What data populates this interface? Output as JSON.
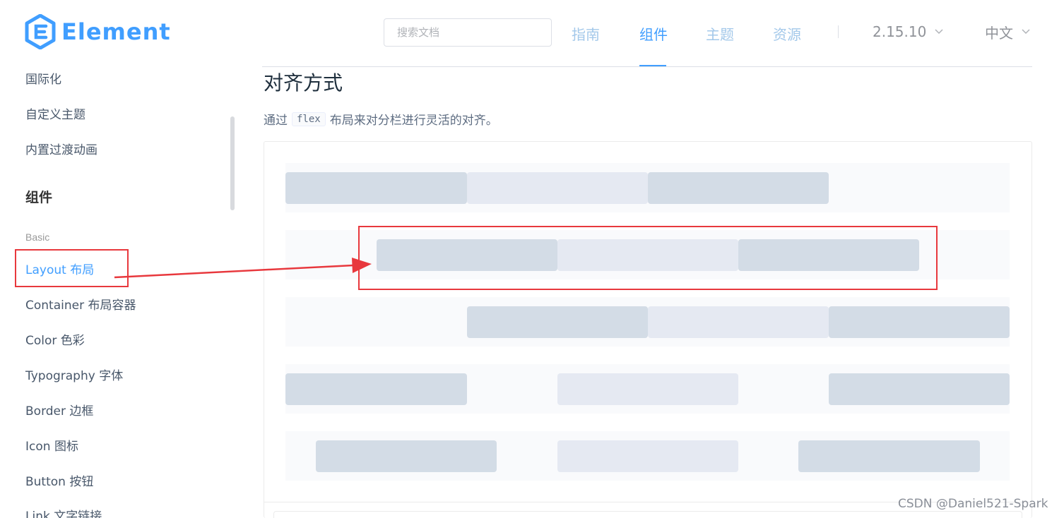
{
  "header": {
    "logo_text": "Element",
    "search_placeholder": "搜索文档",
    "nav": [
      {
        "label": "指南",
        "active": false
      },
      {
        "label": "组件",
        "active": true
      },
      {
        "label": "主题",
        "active": false
      },
      {
        "label": "资源",
        "active": false
      }
    ],
    "version": "2.15.10",
    "language": "中文"
  },
  "sidebar": {
    "items_top": [
      "国际化",
      "自定义主题",
      "内置过渡动画"
    ],
    "group_title": "组件",
    "category": "Basic",
    "items": [
      {
        "label": "Layout 布局",
        "active": true
      },
      {
        "label": "Container 布局容器",
        "active": false
      },
      {
        "label": "Color 色彩",
        "active": false
      },
      {
        "label": "Typography 字体",
        "active": false
      },
      {
        "label": "Border 边框",
        "active": false
      },
      {
        "label": "Icon 图标",
        "active": false
      },
      {
        "label": "Button 按钮",
        "active": false
      },
      {
        "label": "Link 文字链接",
        "active": false
      }
    ]
  },
  "main": {
    "title": "对齐方式",
    "desc_before": "通过",
    "desc_code": "flex",
    "desc_after": "布局来对分栏进行灵活的对齐。"
  },
  "colors": {
    "primary": "#409eff",
    "col_dark": "#d3dce6",
    "col_light": "#e5e9f2",
    "row_bg": "#f9fafc",
    "annotation": "#e8383d"
  },
  "watermark": "CSDN @Daniel521-Spark"
}
